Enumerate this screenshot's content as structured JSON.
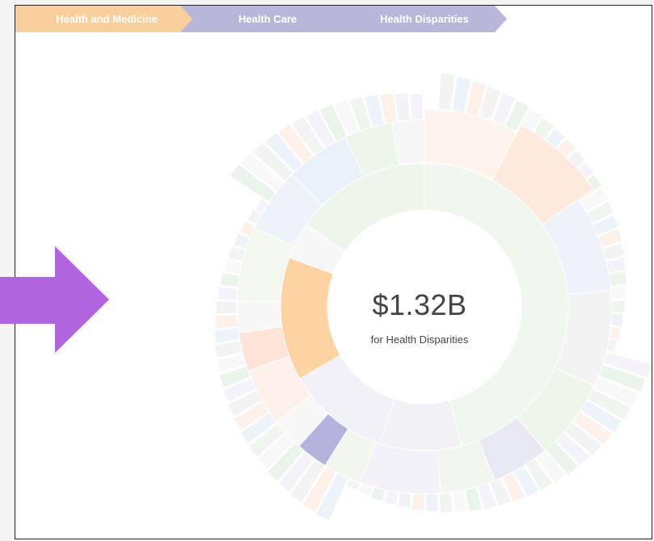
{
  "breadcrumb": {
    "items": [
      {
        "label": "Health and Medicine",
        "color": "#f9cf9e"
      },
      {
        "label": "Health Care",
        "color": "#b7b7d9"
      },
      {
        "label": "Health Disparities",
        "color": "#b7b7d9"
      }
    ]
  },
  "center": {
    "value": "$1.32B",
    "label": "for Health Disparities"
  },
  "colors": {
    "accent_orange": "#fdd3a4",
    "accent_purple": "#b3b3dd",
    "arrow": "#b065de"
  },
  "icons": {
    "pointer": "arrow-right-icon"
  }
}
